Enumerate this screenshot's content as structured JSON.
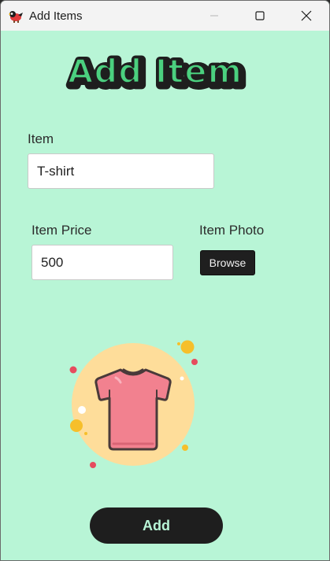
{
  "window": {
    "title": "Add Items"
  },
  "heading": {
    "text": "Add Item"
  },
  "form": {
    "item_label": "Item",
    "item_value": "T-shirt",
    "price_label": "Item Price",
    "price_value": "500",
    "photo_label": "Item Photo",
    "browse_label": "Browse"
  },
  "actions": {
    "add_label": "Add"
  },
  "colors": {
    "background": "#b8f5d6",
    "heading_fill": "#4bd07f",
    "heading_outline": "#1e1e1e",
    "button_dark": "#1e1e1e",
    "shirt": "#f2818f",
    "shirt_circle": "#fedd9a"
  },
  "icons": {
    "app": "bird-app-icon",
    "minimize": "minimize-icon",
    "maximize": "maximize-icon",
    "close": "close-icon",
    "illustration": "tshirt-icon"
  }
}
